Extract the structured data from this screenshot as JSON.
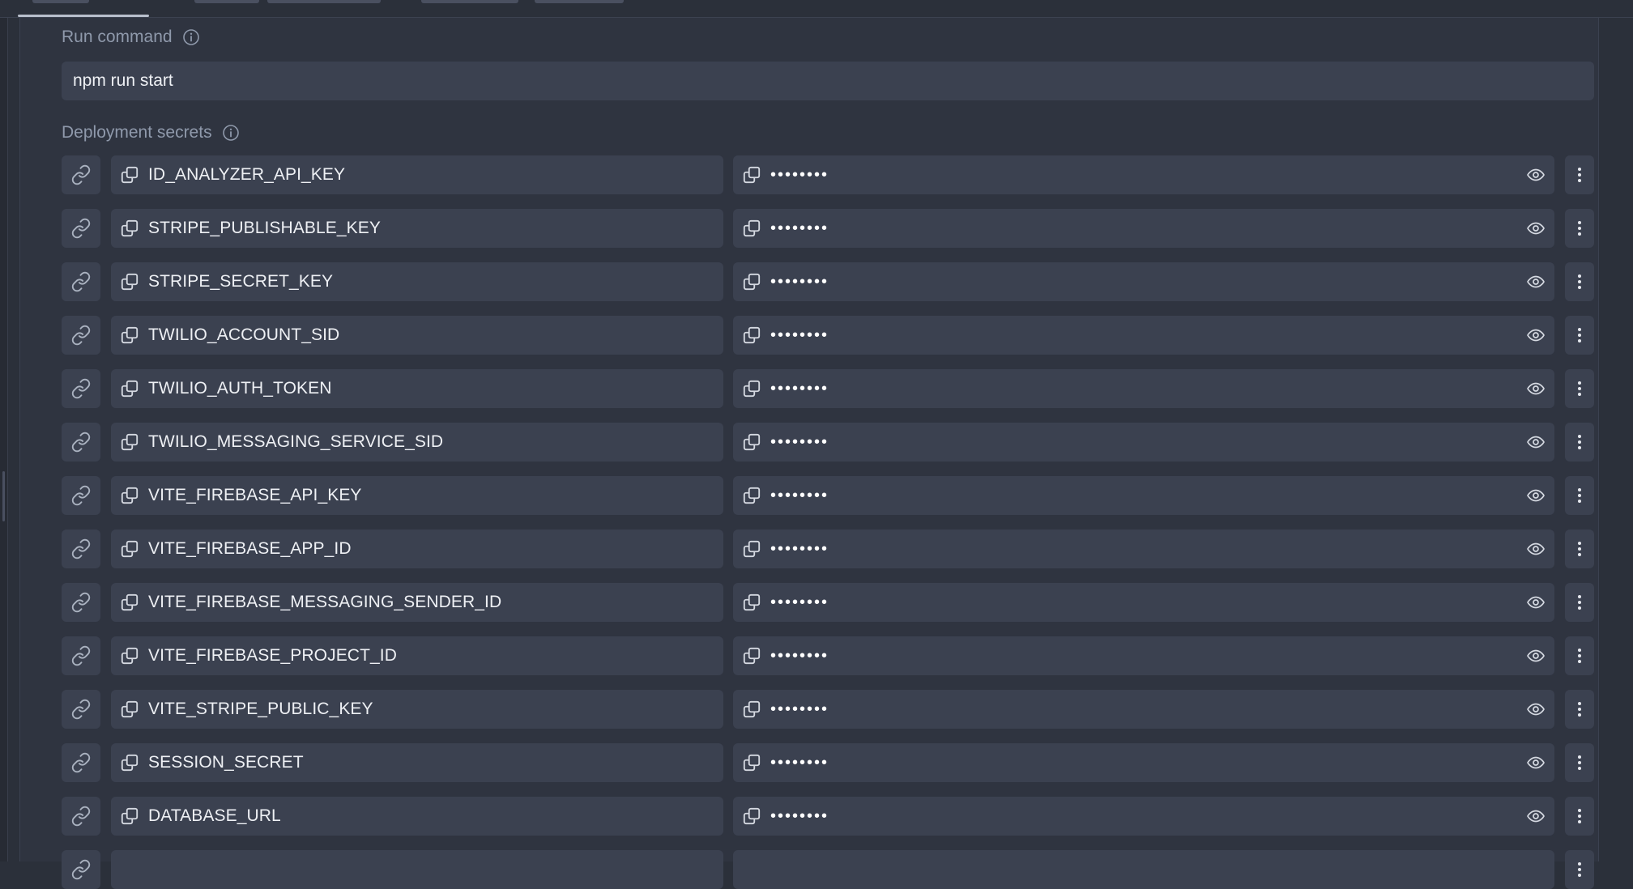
{
  "run_command": {
    "label": "Run command",
    "value": "npm run start"
  },
  "deployment_secrets": {
    "label": "Deployment secrets",
    "items": [
      {
        "key": "ID_ANALYZER_API_KEY",
        "masked_value": "••••••••"
      },
      {
        "key": "STRIPE_PUBLISHABLE_KEY",
        "masked_value": "••••••••"
      },
      {
        "key": "STRIPE_SECRET_KEY",
        "masked_value": "••••••••"
      },
      {
        "key": "TWILIO_ACCOUNT_SID",
        "masked_value": "••••••••"
      },
      {
        "key": "TWILIO_AUTH_TOKEN",
        "masked_value": "••••••••"
      },
      {
        "key": "TWILIO_MESSAGING_SERVICE_SID",
        "masked_value": "••••••••"
      },
      {
        "key": "VITE_FIREBASE_API_KEY",
        "masked_value": "••••••••"
      },
      {
        "key": "VITE_FIREBASE_APP_ID",
        "masked_value": "••••••••"
      },
      {
        "key": "VITE_FIREBASE_MESSAGING_SENDER_ID",
        "masked_value": "••••••••"
      },
      {
        "key": "VITE_FIREBASE_PROJECT_ID",
        "masked_value": "••••••••"
      },
      {
        "key": "VITE_STRIPE_PUBLIC_KEY",
        "masked_value": "••••••••"
      },
      {
        "key": "SESSION_SECRET",
        "masked_value": "••••••••"
      },
      {
        "key": "DATABASE_URL",
        "masked_value": "••••••••"
      },
      {
        "key": "",
        "masked_value": ""
      }
    ]
  },
  "icons": {
    "info": "info-icon",
    "link": "link-icon",
    "copy": "copy-icon",
    "eye": "eye-icon",
    "more": "more-vertical-icon"
  },
  "colors": {
    "background": "#2b303a",
    "panel": "#2f3440",
    "field": "#3b4150",
    "label": "#8f99ab",
    "text": "#eef0f4",
    "icon": "#c9ced8"
  }
}
